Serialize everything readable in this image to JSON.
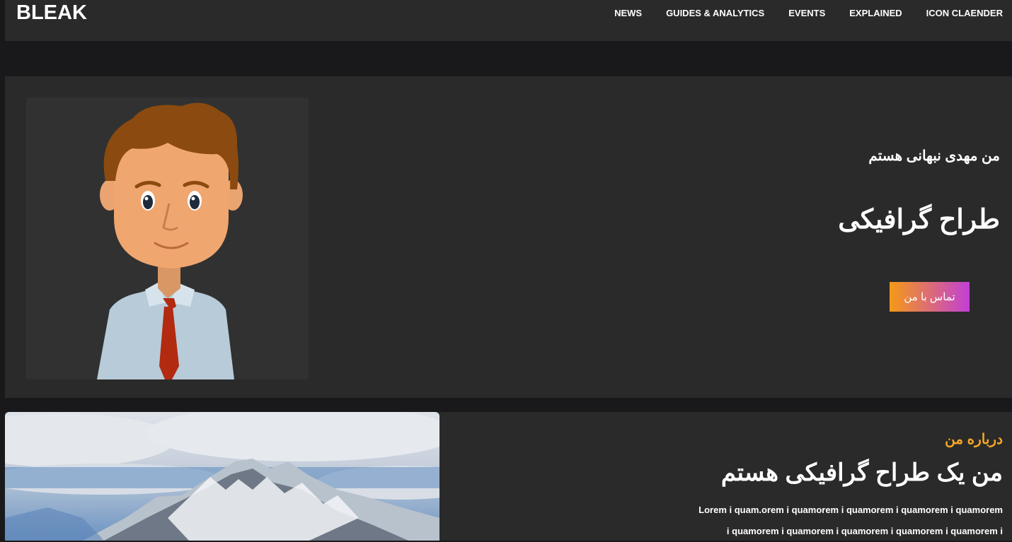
{
  "navbar": {
    "brand": "BLEAK",
    "links": [
      "NEWS",
      "GUIDES & ANALYTICS",
      "EVENTS",
      "EXPLAINED",
      "ICON CLAENDER"
    ]
  },
  "hero": {
    "subtitle": "من مهدی نبهانی هستم",
    "title": "طراح گرافیکی",
    "button_label": "تماس با من",
    "avatar_icon": "cartoon-man-avatar"
  },
  "about": {
    "label": "درباره من",
    "title": "من یک طراح گرافیکی هستم",
    "text_lines": [
      "Lorem i quam.orem i quamorem i quamorem i quamorem i quamorem",
      "i quamorem i quamorem i quamorem i quamorem i quamorem i"
    ]
  },
  "colors": {
    "accent_orange": "#f5a623",
    "gradient_start": "#f59a16",
    "gradient_end": "#c23fd6",
    "panel": "#2a2a2a",
    "background": "#19191b"
  }
}
